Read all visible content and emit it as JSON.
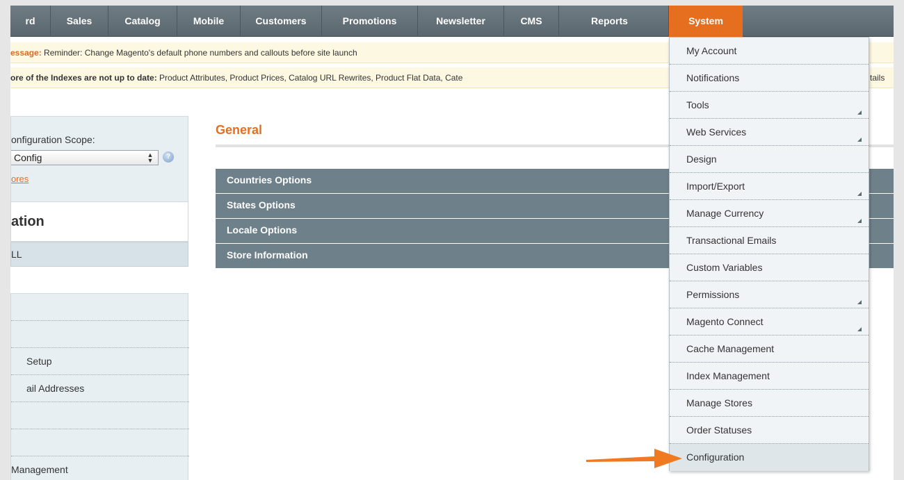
{
  "nav": {
    "items": [
      {
        "label": "rd"
      },
      {
        "label": "Sales"
      },
      {
        "label": "Catalog"
      },
      {
        "label": "Mobile"
      },
      {
        "label": "Customers"
      },
      {
        "label": "Promotions"
      },
      {
        "label": "Newsletter"
      },
      {
        "label": "CMS"
      },
      {
        "label": "Reports"
      },
      {
        "label": "System",
        "active": true
      }
    ]
  },
  "messages": {
    "reminder": {
      "prefix": "essage:",
      "text": " Reminder: Change Magento's default phone numbers and callouts before site launch"
    },
    "indexes": {
      "prefix": "ore of the Indexes are not up to date:",
      "text": " Product Attributes, Product Prices, Catalog URL Rewrites, Product Flat Data, Cate",
      "tail": "tails"
    }
  },
  "left": {
    "scope_label": "onfiguration Scope:",
    "scope_value": "Config",
    "scope_link": "ores",
    "section_title": "ation",
    "section_sub": "LL",
    "list": [
      {
        "label": ""
      },
      {
        "label": ""
      },
      {
        "label": "Setup"
      },
      {
        "label": "ail Addresses"
      },
      {
        "label": ""
      },
      {
        "label": ""
      },
      {
        "label": "Management"
      }
    ]
  },
  "main": {
    "title": "General",
    "fieldsets": [
      {
        "label": "Countries Options"
      },
      {
        "label": "States Options"
      },
      {
        "label": "Locale Options"
      },
      {
        "label": "Store Information"
      }
    ]
  },
  "dropdown": {
    "items": [
      {
        "label": "My Account",
        "submenu": false
      },
      {
        "label": "Notifications",
        "submenu": false
      },
      {
        "label": "Tools",
        "submenu": true
      },
      {
        "label": "Web Services",
        "submenu": true
      },
      {
        "label": "Design",
        "submenu": false
      },
      {
        "label": "Import/Export",
        "submenu": true
      },
      {
        "label": "Manage Currency",
        "submenu": true
      },
      {
        "label": "Transactional Emails",
        "submenu": false
      },
      {
        "label": "Custom Variables",
        "submenu": false
      },
      {
        "label": "Permissions",
        "submenu": true
      },
      {
        "label": "Magento Connect",
        "submenu": true
      },
      {
        "label": "Cache Management",
        "submenu": false
      },
      {
        "label": "Index Management",
        "submenu": false
      },
      {
        "label": "Manage Stores",
        "submenu": false
      },
      {
        "label": "Order Statuses",
        "submenu": false
      },
      {
        "label": "Configuration",
        "submenu": false,
        "active": true
      }
    ]
  },
  "colors": {
    "accent": "#e66f1f",
    "nav_bg": "#5a676e",
    "fieldset_bg": "#6e8089",
    "message_bg": "#fdf8e2",
    "arrow": "#f07a22"
  },
  "icons": {
    "help": "help-icon",
    "select_arrows": "select-arrows-icon",
    "submenu": "submenu-arrow-icon",
    "pointer": "pointer-arrow-icon"
  }
}
